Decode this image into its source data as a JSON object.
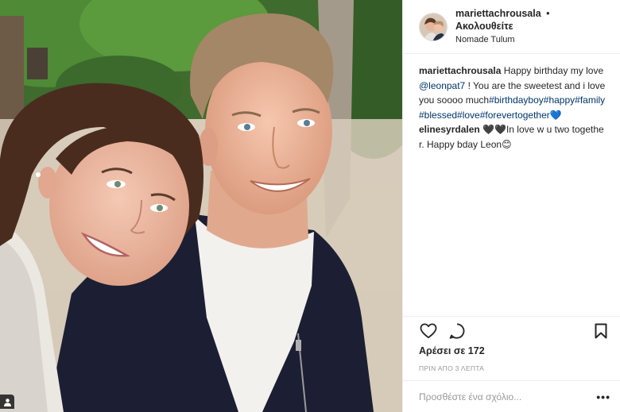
{
  "post": {
    "username": "mariettachrousala",
    "follow_label": "Ακολουθείτε",
    "separator": "•",
    "location": "Nomade Tulum"
  },
  "caption": {
    "username": "mariettachrousala",
    "text_start": "Happy birthday my love ",
    "mention": "@leonpat7",
    "text_mid": " ! You are the sweetest and i love you soooo much",
    "hashtags": "#birthdayboy#happy#family#blessed#love#forevertogether",
    "emoji": "💙"
  },
  "comment": {
    "username": "elinesyrdalen",
    "text": "🖤🖤In love w u two together. Happy bday Leon😊"
  },
  "actions": {
    "like_icon": "heart-icon",
    "comment_icon": "comment-bubble-icon",
    "save_icon": "bookmark-icon"
  },
  "likes_text": "Αρέσει σε 172",
  "time_text": "ΠΡΙΝ ΑΠΟ 3 ΛΕΠΤΑ",
  "add_comment": {
    "placeholder": "Προσθέστε ένα σχόλιο...",
    "more_label": "•••"
  },
  "colors": {
    "link": "#003569",
    "text": "#262626",
    "muted": "#999999",
    "border": "#efefef"
  }
}
